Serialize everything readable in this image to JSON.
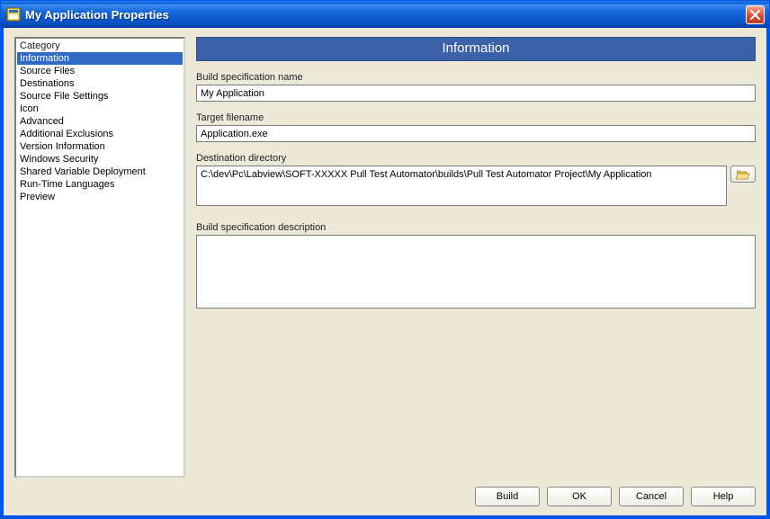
{
  "window": {
    "title": "My Application Properties"
  },
  "sidebar": {
    "header": "Category",
    "items": [
      "Information",
      "Source Files",
      "Destinations",
      "Source File Settings",
      "Icon",
      "Advanced",
      "Additional Exclusions",
      "Version Information",
      "Windows Security",
      "Shared Variable Deployment",
      "Run-Time Languages",
      "Preview"
    ],
    "selected_index": 0
  },
  "panel": {
    "header": "Information",
    "spec_name_label": "Build specification name",
    "spec_name_value": "My Application",
    "target_filename_label": "Target filename",
    "target_filename_value": "Application.exe",
    "dest_dir_label": "Destination directory",
    "dest_dir_value": "C:\\dev\\Pc\\Labview\\SOFT-XXXXX Pull Test Automator\\builds\\Pull Test Automator Project\\My Application",
    "description_label": "Build specification description",
    "description_value": ""
  },
  "buttons": {
    "build": "Build",
    "ok": "OK",
    "cancel": "Cancel",
    "help": "Help"
  }
}
